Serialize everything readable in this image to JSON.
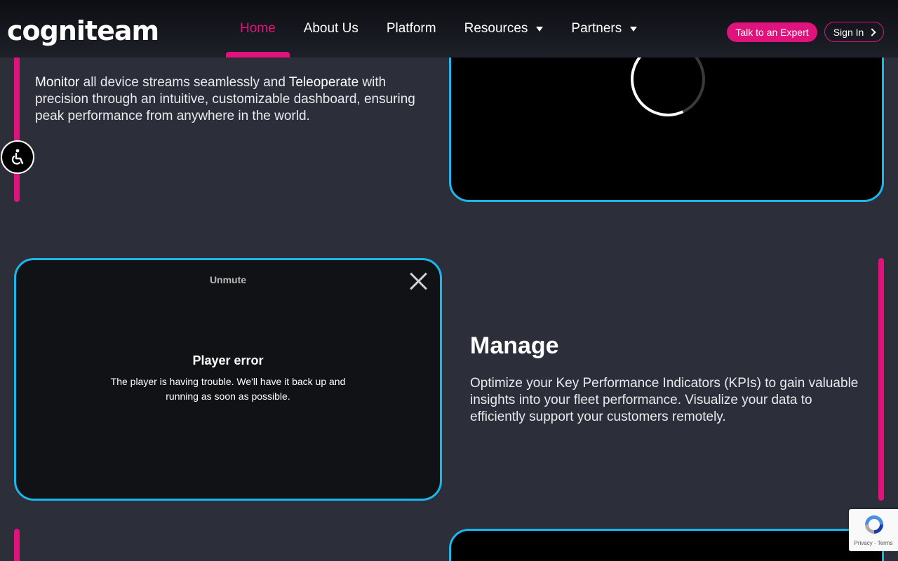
{
  "header": {
    "logo": "cogniteam",
    "nav": [
      {
        "label": "Home",
        "active": true
      },
      {
        "label": "About Us"
      },
      {
        "label": "Platform"
      },
      {
        "label": "Resources",
        "dropdown": true
      },
      {
        "label": "Partners",
        "dropdown": true
      }
    ],
    "cta_expert": "Talk to an Expert",
    "cta_signin": "Sign In"
  },
  "section1": {
    "text_part1": "Monitor",
    "text_part2": " all device streams seamlessly and ",
    "text_part3": "Teleoperate",
    "text_part4": " with precision through an intuitive, customizable dashboard, ensuring peak performance from anywhere in the world."
  },
  "player": {
    "unmute": "Unmute",
    "error_title": "Player error",
    "error_message": "The player is having trouble. We'll have it back up and running as soon as possible."
  },
  "section2": {
    "title": "Manage",
    "text": "Optimize your Key Performance Indicators (KPIs) to gain valuable insights into your fleet performance. Visualize your data to efficiently support your customers remotely."
  },
  "recaptcha": {
    "text": "Privacy - Terms"
  },
  "colors": {
    "accent_pink": "#e0127c",
    "accent_blue": "#1ab8ea",
    "background": "#2c2f3a"
  }
}
